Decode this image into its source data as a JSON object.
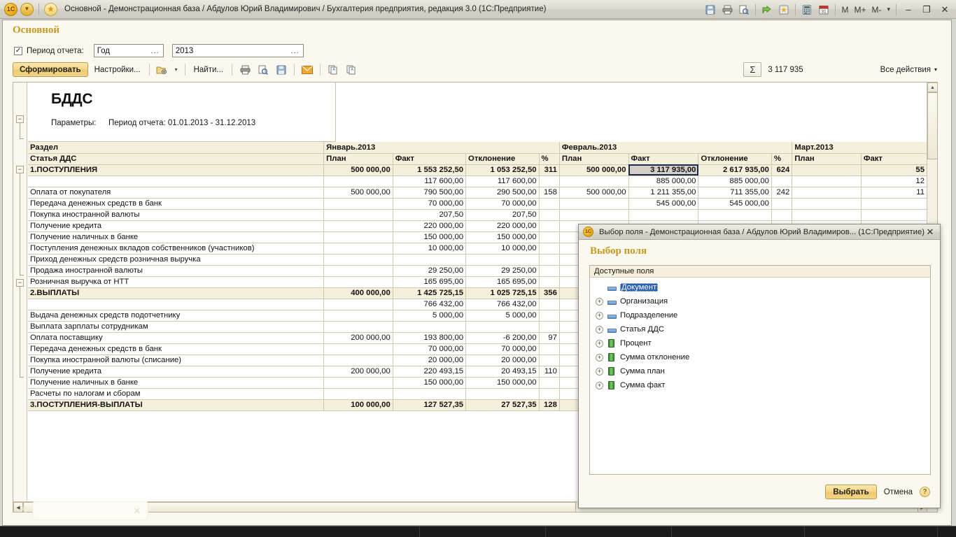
{
  "titlebar": {
    "title": "Основной - Демонстрационная база / Абдулов Юрий Владимирович / Бухгалтерия предприятия, редакция 3.0  (1С:Предприятие)",
    "icons": [
      "save-icon",
      "print-icon",
      "print-preview-icon",
      "navigate-icon",
      "favorites-icon",
      "calculator-icon",
      "calendar-icon"
    ],
    "mem": {
      "m": "M",
      "mplus": "M+",
      "mminus": "M-",
      "dropdown": "▾"
    },
    "window": {
      "minimize": "–",
      "restore": "❐",
      "close": "✕"
    }
  },
  "page": {
    "title": "Основной"
  },
  "period": {
    "checkbox_checked": "✓",
    "label": "Период отчета:",
    "kind_value": "Год",
    "kind_placeholder": "Год",
    "year_value": "2013",
    "year_placeholder": "2013",
    "ellipsis": "..."
  },
  "toolbar": {
    "generate_label": "Сформировать",
    "settings_label": "Настройки...",
    "find_label": "Найти...",
    "folder_icon": "folder-settings-icon",
    "dropdown_caret": "▾",
    "print_icon": "print-icon",
    "preview_icon": "print-preview-icon",
    "save_icon": "save-icon",
    "mail_icon": "mail-icon",
    "copy_icon": "copy-text-icon",
    "copy2_icon": "copy-text-alt-icon",
    "sum_symbol": "Σ",
    "sum_value": "3 117 935",
    "all_actions_label": "Все действия",
    "all_actions_caret": "▾"
  },
  "report": {
    "title": "БДДС",
    "params_label": "Параметры:",
    "params_value": "Период отчета: 01.01.2013 - 31.12.2013",
    "group_collapse_glyph": "−",
    "header_row1": {
      "section": "Раздел",
      "jan": "Январь.2013",
      "feb": "Февраль.2013",
      "mar": "Март.2013"
    },
    "header_row2": {
      "article": "Статья ДДС",
      "plan": "План",
      "fact": "Факт",
      "dev": "Отклонение",
      "pct": "%"
    },
    "selected_cell": "3 117 935,00",
    "rows": [
      {
        "type": "group",
        "label": "1.ПОСТУПЛЕНИЯ",
        "jan": [
          "500 000,00",
          "1 553 252,50",
          "1 053 252,50",
          "311"
        ],
        "feb": [
          "500 000,00",
          "3 117 935,00",
          "2 617 935,00",
          "624"
        ],
        "mar": [
          "",
          "55"
        ],
        "selected_feb_fact": true
      },
      {
        "type": "item",
        "label": "",
        "jan": [
          "",
          "117 600,00",
          "117 600,00",
          ""
        ],
        "feb": [
          "",
          "885 000,00",
          "885 000,00",
          ""
        ],
        "mar": [
          "",
          "12"
        ]
      },
      {
        "type": "item",
        "label": "Оплата от покупателя",
        "jan": [
          "500 000,00",
          "790 500,00",
          "290 500,00",
          "158"
        ],
        "feb": [
          "500 000,00",
          "1 211 355,00",
          "711 355,00",
          "242"
        ],
        "mar": [
          "",
          "11"
        ]
      },
      {
        "type": "item",
        "label": "Передача денежных средств в банк",
        "jan": [
          "",
          "70 000,00",
          "70 000,00",
          ""
        ],
        "feb": [
          "",
          "545 000,00",
          "545 000,00",
          ""
        ],
        "mar": [
          "",
          ""
        ]
      },
      {
        "type": "item",
        "label": "Покупка иностранной валюты",
        "jan": [
          "",
          "207,50",
          "207,50",
          ""
        ],
        "feb": [
          "",
          "",
          "",
          ""
        ],
        "mar": [
          "",
          ""
        ]
      },
      {
        "type": "item",
        "label": "Получение кредита",
        "jan": [
          "",
          "220 000,00",
          "220 000,00",
          ""
        ],
        "feb": [
          "",
          "",
          "",
          ""
        ],
        "mar": [
          "",
          ""
        ]
      },
      {
        "type": "item",
        "label": "Получение наличных в банке",
        "jan": [
          "",
          "150 000,00",
          "150 000,00",
          ""
        ],
        "feb": [
          "",
          "",
          "",
          ""
        ],
        "mar": [
          "",
          ""
        ]
      },
      {
        "type": "item",
        "label": "Поступления денежных вкладов собственников (участников)",
        "jan": [
          "",
          "10 000,00",
          "10 000,00",
          ""
        ],
        "feb": [
          "",
          "",
          "",
          ""
        ],
        "mar": [
          "",
          ""
        ]
      },
      {
        "type": "item",
        "label": "Приход денежных средств розничная выручка",
        "jan": [
          "",
          "",
          "",
          ""
        ],
        "feb": [
          "",
          "",
          "",
          ""
        ],
        "mar": [
          "",
          ""
        ]
      },
      {
        "type": "item",
        "label": "Продажа иностранной валюты",
        "jan": [
          "",
          "29 250,00",
          "29 250,00",
          ""
        ],
        "feb": [
          "",
          "",
          "",
          ""
        ],
        "mar": [
          "",
          ""
        ]
      },
      {
        "type": "item",
        "label": "Розничная выручка от НТТ",
        "jan": [
          "",
          "165 695,00",
          "165 695,00",
          ""
        ],
        "feb": [
          "",
          "",
          "",
          ""
        ],
        "mar": [
          "",
          ""
        ]
      },
      {
        "type": "group",
        "label": "2.ВЫПЛАТЫ",
        "jan": [
          "400 000,00",
          "1 425 725,15",
          "1 025 725,15",
          "356"
        ],
        "feb": [
          "",
          "",
          "",
          ""
        ],
        "mar": [
          "",
          ""
        ]
      },
      {
        "type": "item",
        "label": "",
        "jan": [
          "",
          "766 432,00",
          "766 432,00",
          ""
        ],
        "feb": [
          "",
          "",
          "",
          ""
        ],
        "mar": [
          "",
          ""
        ]
      },
      {
        "type": "item",
        "label": "Выдача денежных средств подотчетнику",
        "jan": [
          "",
          "5 000,00",
          "5 000,00",
          ""
        ],
        "feb": [
          "",
          "",
          "",
          ""
        ],
        "mar": [
          "",
          ""
        ]
      },
      {
        "type": "item",
        "label": "Выплата зарплаты сотрудникам",
        "jan": [
          "",
          "",
          "",
          ""
        ],
        "feb": [
          "",
          "",
          "",
          ""
        ],
        "mar": [
          "",
          ""
        ]
      },
      {
        "type": "item",
        "label": "Оплата поставщику",
        "jan": [
          "200 000,00",
          "193 800,00",
          "-6 200,00",
          "97"
        ],
        "feb": [
          "",
          "",
          "",
          ""
        ],
        "mar": [
          "",
          ""
        ]
      },
      {
        "type": "item",
        "label": "Передача денежных средств в банк",
        "jan": [
          "",
          "70 000,00",
          "70 000,00",
          ""
        ],
        "feb": [
          "",
          "",
          "",
          ""
        ],
        "mar": [
          "",
          ""
        ]
      },
      {
        "type": "item",
        "label": "Покупка иностранной валюты (списание)",
        "jan": [
          "",
          "20 000,00",
          "20 000,00",
          ""
        ],
        "feb": [
          "",
          "",
          "",
          ""
        ],
        "mar": [
          "",
          ""
        ]
      },
      {
        "type": "item",
        "label": "Получение кредита",
        "jan": [
          "200 000,00",
          "220 493,15",
          "20 493,15",
          "110"
        ],
        "feb": [
          "",
          "",
          "",
          ""
        ],
        "mar": [
          "",
          ""
        ]
      },
      {
        "type": "item",
        "label": "Получение наличных в банке",
        "jan": [
          "",
          "150 000,00",
          "150 000,00",
          ""
        ],
        "feb": [
          "",
          "",
          "",
          ""
        ],
        "mar": [
          "",
          ""
        ]
      },
      {
        "type": "item",
        "label": "Расчеты по налогам и сборам",
        "jan": [
          "",
          "",
          "",
          ""
        ],
        "feb": [
          "",
          "",
          "",
          ""
        ],
        "mar": [
          "",
          ""
        ]
      },
      {
        "type": "group",
        "label": "3.ПОСТУПЛЕНИЯ-ВЫПЛАТЫ",
        "jan": [
          "100 000,00",
          "127 527,35",
          "27 527,35",
          "128"
        ],
        "feb": [
          "",
          "",
          "",
          ""
        ],
        "mar": [
          "",
          ""
        ]
      }
    ]
  },
  "scroll": {
    "up_arrow": "▲",
    "down_arrow": "▼",
    "left_arrow": "◀",
    "right_arrow": "▶"
  },
  "ghost_field": {
    "clear_glyph": "✕"
  },
  "dialog": {
    "title": "Выбор поля - Демонстрационная база / Абдулов Юрий Владимиров...  (1С:Предприятие)",
    "close_glyph": "✕",
    "heading": "Выбор поля",
    "list_header": "Доступные поля",
    "items": [
      {
        "label": "Документ",
        "icon": "reference-field-icon",
        "expandable": false,
        "selected": true
      },
      {
        "label": "Организация",
        "icon": "reference-field-icon",
        "expandable": true,
        "selected": false
      },
      {
        "label": "Подразделение",
        "icon": "reference-field-icon",
        "expandable": true,
        "selected": false
      },
      {
        "label": "Статья ДДС",
        "icon": "reference-field-icon",
        "expandable": true,
        "selected": false
      },
      {
        "label": "Процент",
        "icon": "numeric-field-icon",
        "expandable": true,
        "selected": false
      },
      {
        "label": "Сумма отклонение",
        "icon": "numeric-field-icon",
        "expandable": true,
        "selected": false
      },
      {
        "label": "Сумма план",
        "icon": "numeric-field-icon",
        "expandable": true,
        "selected": false
      },
      {
        "label": "Сумма факт",
        "icon": "numeric-field-icon",
        "expandable": true,
        "selected": false
      }
    ],
    "expand_glyph": "+",
    "select_button": "Выбрать",
    "cancel_button": "Отмена",
    "help_glyph": "?"
  },
  "colors": {
    "accent_gold": "#c49a22",
    "header_cream": "#f5f0dc",
    "window_bg": "#fbf9ef",
    "selection_blue": "#2a5fb0"
  }
}
